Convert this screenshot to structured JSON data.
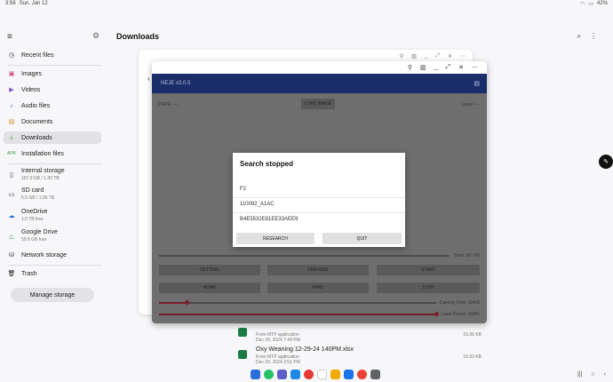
{
  "statusbar": {
    "time": "3:56",
    "date": "Sun, Jan 12",
    "battery": "42%"
  },
  "sidebar": {
    "items": [
      {
        "label": "Recent files",
        "icon": "clock-icon"
      },
      {
        "label": "Images",
        "icon": "image-icon"
      },
      {
        "label": "Videos",
        "icon": "video-icon"
      },
      {
        "label": "Audio files",
        "icon": "music-icon"
      },
      {
        "label": "Documents",
        "icon": "document-icon"
      },
      {
        "label": "Downloads",
        "icon": "download-icon",
        "active": true
      },
      {
        "label": "Installation files",
        "icon": "apk-icon"
      },
      {
        "label": "Internal storage",
        "sub": "107.9 GB / 1.00 TB",
        "icon": "phone-icon"
      },
      {
        "label": "SD card",
        "sub": "5.5 GB / 1.00 TB",
        "icon": "sdcard-icon"
      },
      {
        "label": "OneDrive",
        "sub": "1.0 TB free",
        "icon": "cloud-icon"
      },
      {
        "label": "Google Drive",
        "sub": "59.8 GB free",
        "icon": "drive-icon"
      },
      {
        "label": "Network storage",
        "icon": "network-icon"
      },
      {
        "label": "Trash",
        "icon": "trash-icon"
      }
    ],
    "manage_storage": "Manage storage"
  },
  "main": {
    "title": "Downloads"
  },
  "files": [
    {
      "name": "",
      "meta1": "From MTP application",
      "meta2": "Dec 29, 2024 7:44 PM",
      "size": "15.06 KB"
    },
    {
      "name": "Oxy Weaning 12-29-24 140PM.xlsx",
      "meta1": "From MTP application",
      "meta2": "Dec 29, 2024 3:51 PM",
      "size": "15.03 KB"
    }
  ],
  "neje": {
    "title": "NEJE v3.0.5",
    "state": "STATE: ---",
    "load_image": "LOAD IMAGE",
    "laser": "Laser: ---",
    "time": "Time: 00 / 00",
    "buttons_row1": [
      "SETTING",
      "PREVIEW",
      "START"
    ],
    "buttons_row2": [
      "HOME",
      "PARK",
      "STOP"
    ],
    "carving_time": {
      "label": "Carving Time: 10mS",
      "level": 0.1
    },
    "laser_power": {
      "label": "Laser Power: 100%",
      "level": 1.0
    }
  },
  "dialog": {
    "title": "Search stopped",
    "rows": [
      "F2",
      "110092_A1AC",
      "B4E5532E81EE33AEE9"
    ],
    "research": "RESEARCH",
    "quit": "QUIT"
  },
  "colors": {
    "app_header": "#1a2d6b",
    "slider": "#7a1d2a"
  }
}
